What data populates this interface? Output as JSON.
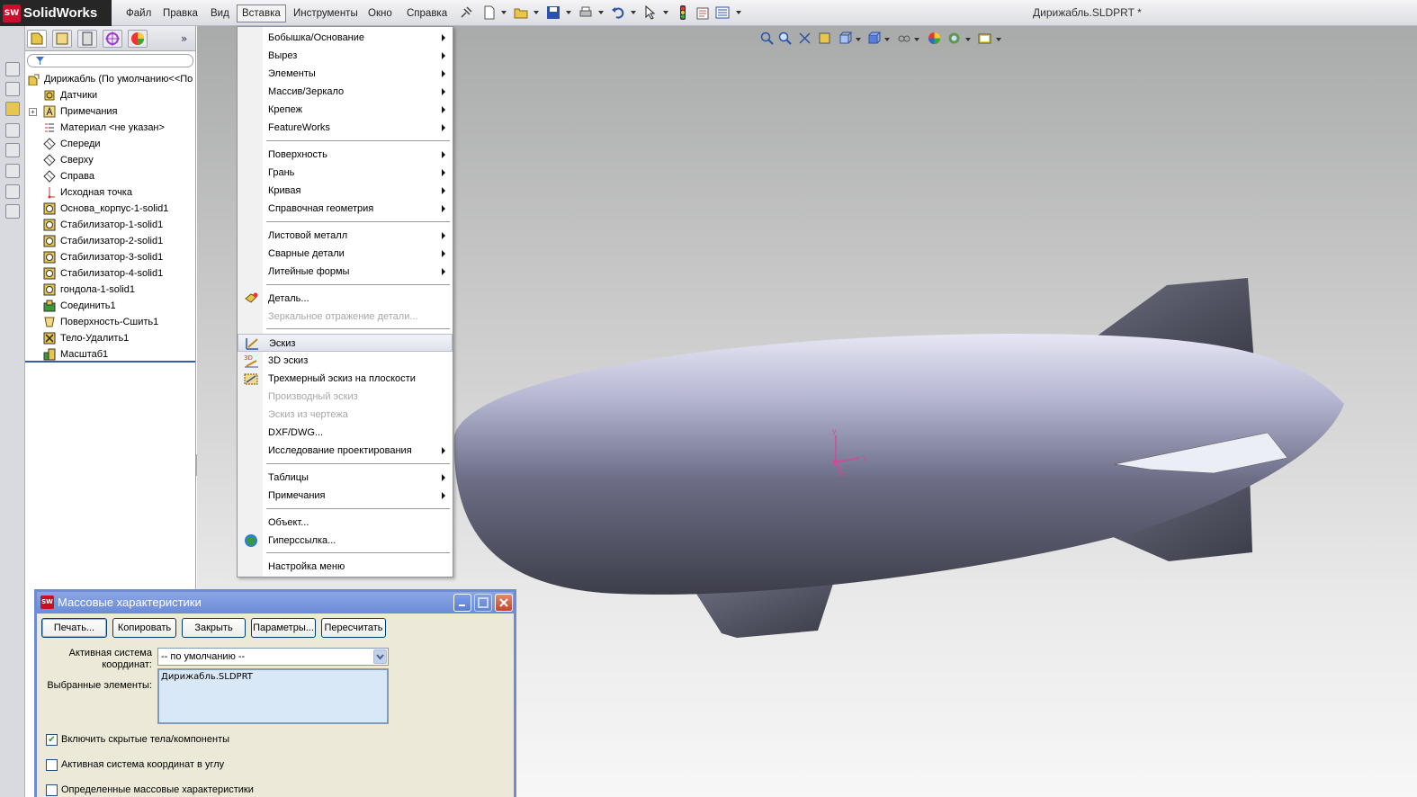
{
  "app": {
    "logo_badge": "SW",
    "logo_text": "SolidWorks",
    "title": "Дирижабль.SLDPRT *"
  },
  "menubar": [
    "Файл",
    "Правка",
    "Вид",
    "Вставка",
    "Инструменты",
    "Окно",
    "Справка"
  ],
  "toolbar_icons": [
    "pin-icon",
    "new-doc-icon",
    "open-icon",
    "save-icon",
    "print-icon",
    "undo-icon",
    "select-arrow-icon",
    "rebuild-icon",
    "options-icon",
    "file-props-icon"
  ],
  "feature_tree": {
    "tabs": [
      "feature-manager-icon",
      "property-manager-icon",
      "configuration-manager-icon",
      "dim-expert-icon",
      "display-manager-icon"
    ],
    "items": [
      {
        "label": "Дирижабль  (По умолчанию<<По",
        "icon": "part-icon",
        "root": true
      },
      {
        "label": "Датчики",
        "icon": "sensors-icon"
      },
      {
        "label": "Примечания",
        "icon": "annotations-icon",
        "expandable": true
      },
      {
        "label": "Материал <не указан>",
        "icon": "material-icon"
      },
      {
        "label": "Спереди",
        "icon": "plane-icon"
      },
      {
        "label": "Сверху",
        "icon": "plane-icon"
      },
      {
        "label": "Справа",
        "icon": "plane-icon"
      },
      {
        "label": "Исходная точка",
        "icon": "origin-icon"
      },
      {
        "label": "Основа_корпус-1-solid1",
        "icon": "body-icon"
      },
      {
        "label": "Стабилизатор-1-solid1",
        "icon": "body-icon"
      },
      {
        "label": "Стабилизатор-2-solid1",
        "icon": "body-icon"
      },
      {
        "label": "Стабилизатор-3-solid1",
        "icon": "body-icon"
      },
      {
        "label": "Стабилизатор-4-solid1",
        "icon": "body-icon"
      },
      {
        "label": "гондола-1-solid1",
        "icon": "body-icon"
      },
      {
        "label": "Соединить1",
        "icon": "combine-icon"
      },
      {
        "label": "Поверхность-Сшить1",
        "icon": "knit-surface-icon"
      },
      {
        "label": "Тело-Удалить1",
        "icon": "delete-body-icon"
      },
      {
        "label": "Масштаб1",
        "icon": "scale-icon"
      }
    ]
  },
  "insert_menu": {
    "items": [
      {
        "label": "Бобышка/Основание",
        "submenu": true
      },
      {
        "label": "Вырез",
        "submenu": true
      },
      {
        "label": "Элементы",
        "submenu": true
      },
      {
        "label": "Массив/Зеркало",
        "submenu": true
      },
      {
        "label": "Крепеж",
        "submenu": true
      },
      {
        "label": "FeatureWorks",
        "submenu": true
      },
      {
        "label": "Поверхность",
        "submenu": true
      },
      {
        "label": "Грань",
        "submenu": true
      },
      {
        "label": "Кривая",
        "submenu": true
      },
      {
        "label": "Справочная геометрия",
        "submenu": true
      },
      {
        "label": "Листовой металл",
        "submenu": true
      },
      {
        "label": "Сварные детали",
        "submenu": true
      },
      {
        "label": "Литейные формы",
        "submenu": true
      },
      {
        "label": "Деталь...",
        "icon": "part-insert-icon"
      },
      {
        "label": "Зеркальное отражение детали...",
        "disabled": true
      },
      {
        "label": "Эскиз",
        "icon": "sketch-icon",
        "highlighted": true
      },
      {
        "label": "3D эскиз",
        "icon": "sketch-3d-icon"
      },
      {
        "label": "Трехмерный эскиз на плоскости",
        "icon": "sketch-3d-plane-icon"
      },
      {
        "label": "Производный эскиз",
        "disabled": true
      },
      {
        "label": "Эскиз из чертежа",
        "disabled": true
      },
      {
        "label": "DXF/DWG..."
      },
      {
        "label": "Исследование проектирования",
        "submenu": true
      },
      {
        "label": "Таблицы",
        "submenu": true
      },
      {
        "label": "Примечания",
        "submenu": true
      },
      {
        "label": "Объект..."
      },
      {
        "label": "Гиперссылка...",
        "icon": "hyperlink-globe-icon"
      },
      {
        "label": "Настройка меню"
      }
    ]
  },
  "triad": {
    "x": "x",
    "y": "y",
    "z": "z"
  },
  "mass_dialog": {
    "title": "Массовые характеристики",
    "icon": "SW",
    "buttons": [
      "Печать...",
      "Копировать",
      "Закрыть",
      "Параметры...",
      "Пересчитать"
    ],
    "coord_label_1": "Активная система",
    "coord_label_2": "координат:",
    "coord_value": "-- по умолчанию --",
    "selected_label": "Выбранные элементы:",
    "selected_value": "Дирижабль.SLDPRT",
    "checkboxes": [
      {
        "label": "Включить скрытые тела/компоненты",
        "checked": true
      },
      {
        "label": "Активная система координат в углу",
        "checked": false
      },
      {
        "label": "Определенные массовые характеристики",
        "checked": false
      }
    ]
  },
  "colors": {
    "accent": "#6b8bd8",
    "menu_highlight": "#dfe2ea",
    "hull": "#5e5f77"
  }
}
